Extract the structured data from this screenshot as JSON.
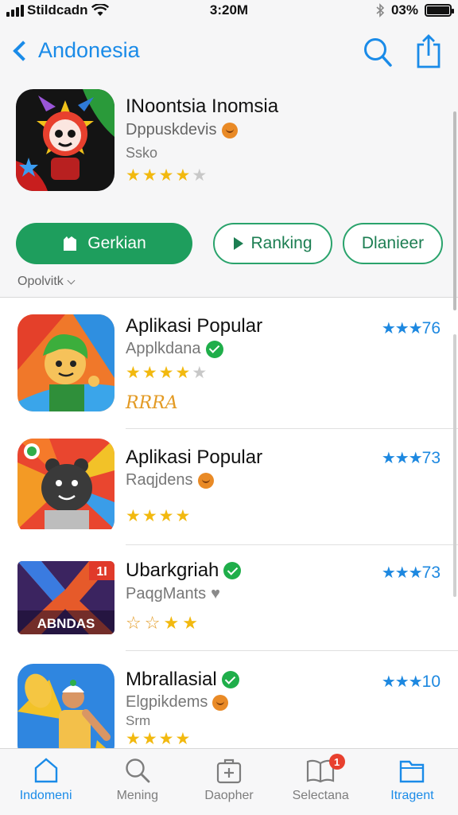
{
  "status_bar": {
    "carrier": "Stildcadn",
    "time": "3:20M",
    "battery": "03%"
  },
  "nav": {
    "back_label": "Andonesia",
    "icons": [
      "search-icon",
      "share-icon"
    ]
  },
  "app": {
    "title": "INoontsia Inomsia",
    "developer": "Dppuskdevis",
    "age": "Ssko",
    "rating_stars": 4
  },
  "actions": {
    "get_label": "Gerkian",
    "ranking_label": "Ranking",
    "download_label": "Dlanieer",
    "options_label": "Opolvitk"
  },
  "list": [
    {
      "title": "Aplikasi Popular",
      "subtitle": "Applkdana",
      "subtitle_badge": "check",
      "score": "76",
      "stars": 4,
      "extra_marks": "RRRA"
    },
    {
      "title": "Aplikasi Popular",
      "subtitle": "Raqjdens",
      "subtitle_badge": "emoji",
      "score": "73",
      "stars": 4
    },
    {
      "title": "Ubarkgriah",
      "title_badge": "check",
      "subtitle": "PaqgMants",
      "subtitle_badge": "heart",
      "score": "73",
      "stars_outline": 4,
      "icon_text": "ABNDAS",
      "icon_corner": "1I"
    },
    {
      "title": "Mbrallasial",
      "title_badge": "check",
      "subtitle": "Elgpikdems",
      "subtitle_badge": "emoji",
      "extra": "Srm",
      "score": "10",
      "stars": 4
    }
  ],
  "tabs": [
    {
      "label": "Indomeni",
      "icon": "home-icon",
      "active": true
    },
    {
      "label": "Mening",
      "icon": "search-icon",
      "active": false
    },
    {
      "label": "Daopher",
      "icon": "briefcase-plus-icon",
      "active": false
    },
    {
      "label": "Selectana",
      "icon": "book-icon",
      "active": false,
      "badge": "1"
    },
    {
      "label": "Itragent",
      "icon": "folder-icon",
      "active": false
    }
  ],
  "colors": {
    "accent_blue": "#1a8be8",
    "get_green": "#1e9e5d",
    "star_yellow": "#f2b90f"
  }
}
